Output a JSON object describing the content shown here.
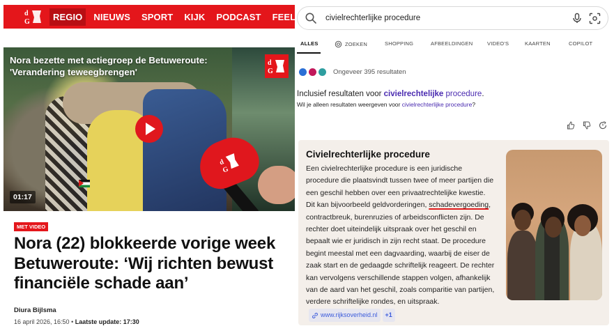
{
  "news": {
    "nav": {
      "items": [
        "REGIO",
        "NIEUWS",
        "SPORT",
        "KIJK",
        "PODCAST",
        "FEELGOOD"
      ],
      "active": "REGIO"
    },
    "video": {
      "title": "Nora bezette met actiegroep de Betuweroute: 'Verandering teweegbrengen'",
      "duration": "01:17"
    },
    "badge": "MET VIDEO",
    "headline": "Nora (22) blokkeerde vorige week Betuweroute: ‘Wij richten bewust financiële schade aan’",
    "author": "Diura Bijlsma",
    "date": "16 april 2026, 16:50",
    "update_label": "Laatste update:",
    "update_time": "17:30",
    "brand_color": "#e4161b"
  },
  "search": {
    "query": "civielrechterlijke procedure",
    "tabs": [
      "ALLES",
      "ZOEKEN",
      "SHOPPING",
      "AFBEELDINGEN",
      "VIDEO'S",
      "KAARTEN",
      "COPILOT"
    ],
    "active_tab": "ALLES",
    "results_count": "Ongeveer 395 resultaten",
    "including_prefix": "Inclusief resultaten voor ",
    "including_bold": "civielrechtelijke",
    "including_rest": " procedure",
    "including_end": ".",
    "only_prefix": "Wil je alleen resultaten weergeven voor ",
    "only_link": "civielrechterlijke procedure",
    "only_end": "?",
    "card": {
      "title": "Civielrechterlijke procedure",
      "body_before": "Een civielrechterlijke procedure is een juridische procedure die plaatsvindt tussen twee of meer partijen die een geschil hebben over een privaatrechtelijke kwestie. Dit kan bijvoorbeeld geldvorderingen, ",
      "body_underlined": "schadevergoeding",
      "body_after": ", contractbreuk, burenruzies of arbeidsconflicten zijn. De rechter doet uiteindelijk uitspraak over het geschil en bepaalt wie er juridisch in zijn recht staat. De procedure begint meestal met een dagvaarding, waarbij de eiser de zaak start en de gedaagde schriftelijk reageert. De rechter kan vervolgens verschillende stappen volgen, afhankelijk van de aard van het geschil, zoals comparitie van partijen, verdere schriftelijke rondes, en uitspraak.",
      "source": "www.rijksoverheid.nl",
      "more_sources": "+1"
    },
    "accent_link_color": "#4a2bb0"
  }
}
